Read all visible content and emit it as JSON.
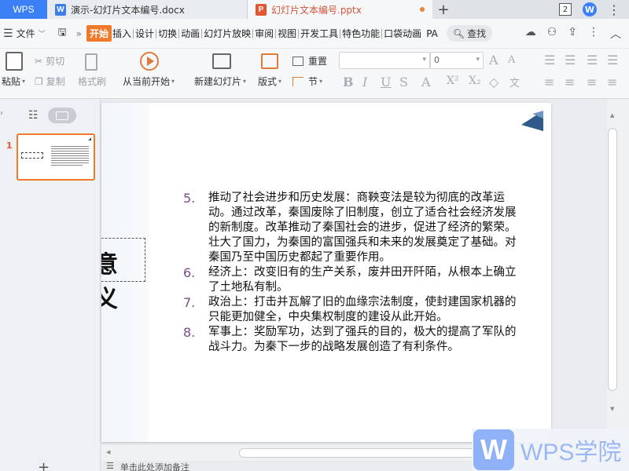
{
  "app": {
    "brand": "WPS",
    "tabs": [
      {
        "label": "演示-幻灯片文本编号.docx",
        "icon": "W"
      },
      {
        "label": "幻灯片文本编号.pptx",
        "icon": "P"
      }
    ],
    "badge": "2"
  },
  "menubar": {
    "file": "文件",
    "items": [
      "开始",
      "插入",
      "设计",
      "切换",
      "动画",
      "幻灯片放映",
      "审阅",
      "视图",
      "开发工具",
      "特色功能",
      "口袋动画",
      "PA"
    ],
    "search": "查找"
  },
  "ribbon": {
    "paste": "粘贴",
    "cut": "剪切",
    "copy": "复制",
    "format_painter": "格式刷",
    "play_from_current": "从当前开始",
    "new_slide": "新建幻灯片",
    "layout": "版式",
    "reset": "重置",
    "section": "节",
    "font_size": "0"
  },
  "left_panel": {
    "slide_number": "1"
  },
  "slide": {
    "title_fragment": "意义",
    "items": [
      {
        "num": "5.",
        "text": "推动了社会进步和历史发展：商鞅变法是较为彻底的改革运动。通过改革，秦国废除了旧制度，创立了适合社会经济发展的新制度。改革推动了秦国社会的进步，促进了经济的繁荣。壮大了国力，为秦国的富国强兵和未来的发展奠定了基础。对秦国乃至中国历史都起了重要作用。"
      },
      {
        "num": "6.",
        "text": "经济上：改变旧有的生产关系，废井田开阡陌，从根本上确立了土地私有制。"
      },
      {
        "num": "7.",
        "text": "政治上：打击并瓦解了旧的血缘宗法制度，使封建国家机器的只能更加健全，中央集权制度的建设从此开始。"
      },
      {
        "num": "8.",
        "text": "军事上：奖励军功，达到了强兵的目的，极大的提高了军队的战斗力。为秦下一步的战略发展创造了有利条件。"
      }
    ]
  },
  "notes": {
    "placeholder": "单击此处添加备注"
  },
  "watermark": {
    "text": "WPS学院",
    "logo": "W"
  }
}
